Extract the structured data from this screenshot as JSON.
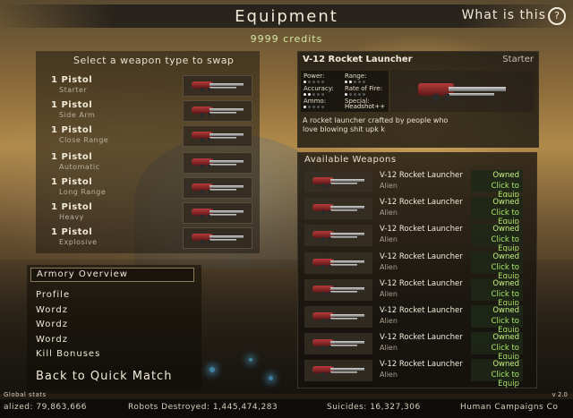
{
  "header": {
    "title": "Equipment",
    "help_label": "What is this",
    "help_icon": "?",
    "credits": "9999 credits"
  },
  "weapon_slots": {
    "header": "Select a weapon type to swap",
    "items": [
      {
        "name": "1 Pistol",
        "type": "Starter"
      },
      {
        "name": "1 Pistol",
        "type": "Side Arm"
      },
      {
        "name": "1 Pistol",
        "type": "Close Range"
      },
      {
        "name": "1 Pistol",
        "type": "Automatic"
      },
      {
        "name": "1 Pistol",
        "type": "Long Range"
      },
      {
        "name": "1 Pistol",
        "type": "Heavy"
      },
      {
        "name": "1 Pistol",
        "type": "Explosive"
      }
    ]
  },
  "menu": {
    "header": "Armory Overview",
    "items": [
      "Profile",
      "Wordz",
      "Wordz",
      "Wordz",
      "Kill Bonuses"
    ],
    "back": "Back to Quick Match"
  },
  "selected_weapon": {
    "name": "V-12 Rocket Launcher",
    "category": "Starter",
    "stats": {
      "power_label": "Power:",
      "power_value": 1,
      "range_label": "Range:",
      "range_value": 2,
      "accuracy_label": "Accuracy:",
      "accuracy_value": 2,
      "rate_label": "Rate of Fire:",
      "rate_value": 1,
      "ammo_label": "Ammo:",
      "ammo_value": 1,
      "special_label": "Special:",
      "special_value": "Headshot++"
    },
    "description": "A rocket launcher crafted by people who love blowing shit upk k"
  },
  "available": {
    "header": "Available Weapons",
    "items": [
      {
        "name": "V-12 Rocket Launcher",
        "faction": "Alien",
        "status": "Owned",
        "action": "Click to Equip"
      },
      {
        "name": "V-12 Rocket Launcher",
        "faction": "Alien",
        "status": "Owned",
        "action": "Click to Equip"
      },
      {
        "name": "V-12 Rocket Launcher",
        "faction": "Alien",
        "status": "Owned",
        "action": "Click to Equip"
      },
      {
        "name": "V-12 Rocket Launcher",
        "faction": "Alien",
        "status": "Owned",
        "action": "Click to Equip"
      },
      {
        "name": "V-12 Rocket Launcher",
        "faction": "Alien",
        "status": "Owned",
        "action": "Click to Equip"
      },
      {
        "name": "V-12 Rocket Launcher",
        "faction": "Alien",
        "status": "Owned",
        "action": "Click to Equip"
      },
      {
        "name": "V-12 Rocket Launcher",
        "faction": "Alien",
        "status": "Owned",
        "action": "Click to Equip"
      },
      {
        "name": "V-12 Rocket Launcher",
        "faction": "Alien",
        "status": "Owned",
        "action": "Click to Equip"
      }
    ]
  },
  "footer": {
    "global_label": "Global stats",
    "version": "v 2.0",
    "realized": "alized: 79,863,666",
    "robots": "Robots Destroyed: 1,445,474,283",
    "suicides": "Suicides: 16,327,306",
    "campaigns": "Human Campaigns Co"
  },
  "colors": {
    "owned_text": "#c8f080",
    "panel_bg": "#19160f",
    "accent_red": "#b83a3a"
  },
  "icons": {
    "weapon": "rocket-launcher-icon",
    "help": "question-circle-icon"
  }
}
